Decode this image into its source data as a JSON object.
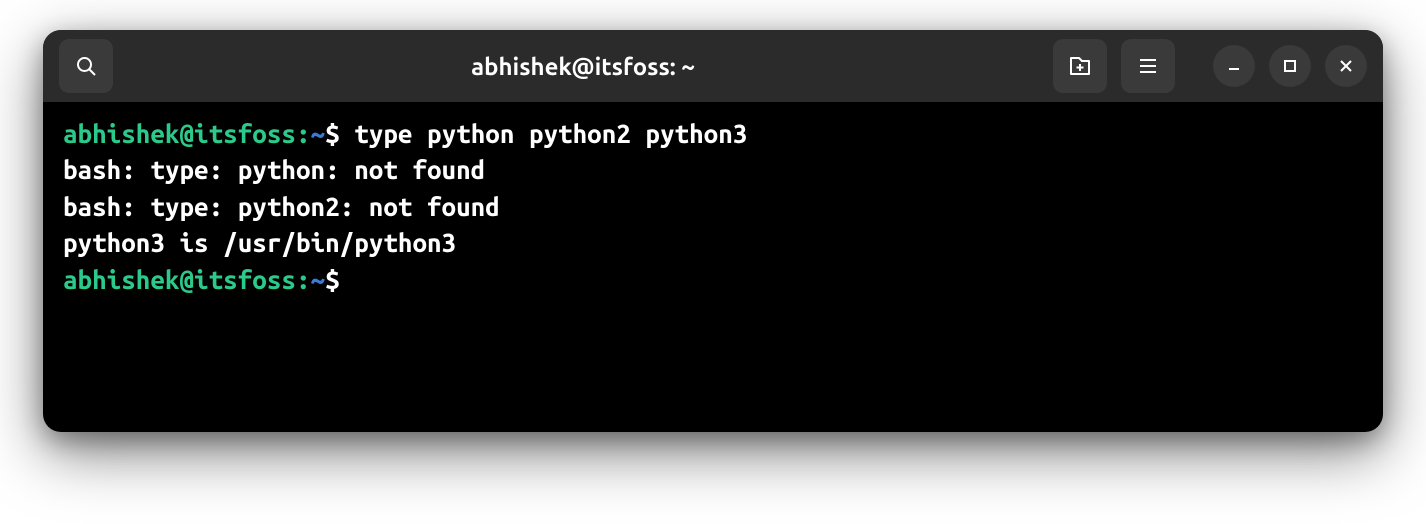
{
  "titlebar": {
    "title": "abhishek@itsfoss: ~"
  },
  "prompt": {
    "user_host": "abhishek@itsfoss",
    "colon": ":",
    "path": "~",
    "dollar": "$ "
  },
  "lines": {
    "cmd1": "type python python2 python3",
    "out1": "bash: type: python: not found",
    "out2": "bash: type: python2: not found",
    "out3": "python3 is /usr/bin/python3"
  },
  "icons": {
    "search": "search-icon",
    "new_tab": "new-tab-icon",
    "menu": "hamburger-icon",
    "minimize": "minimize-icon",
    "maximize": "maximize-icon",
    "close": "close-icon"
  }
}
